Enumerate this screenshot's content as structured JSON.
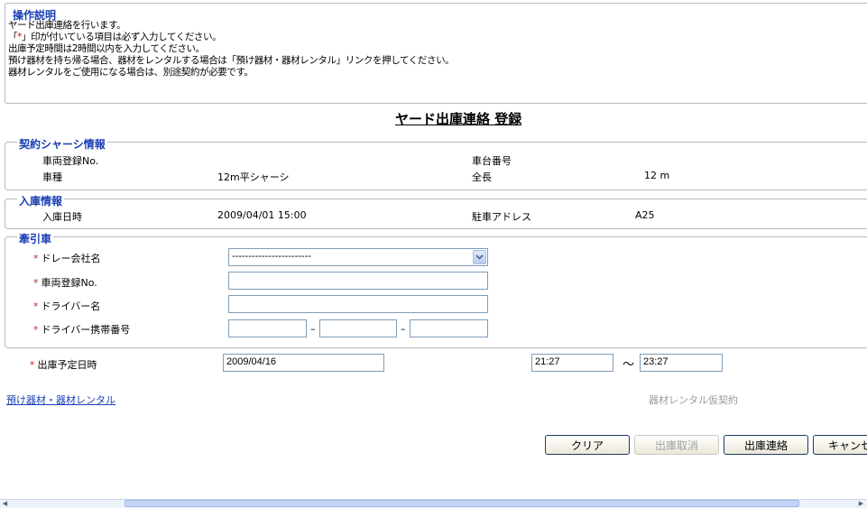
{
  "instructions": {
    "title": "操作説明",
    "line1": "ヤード出庫連絡を行います。",
    "line2_pre": "「",
    "line2_star": "*",
    "line2_post": "」印が付いている項目は必ず入力してください。",
    "line3": "出庫予定時間は2時間以内を入力してください。",
    "line4": "預け器材を持ち帰る場合、器材をレンタルする場合は「預け器材・器材レンタル」リンクを押してください。",
    "line5": "器材レンタルをご使用になる場合は、別途契約が必要です。"
  },
  "page_title": "ヤード出庫連絡 登録",
  "chassis": {
    "legend": "契約シャーシ情報",
    "reg_no_label": "車両登録No.",
    "reg_no_value": "",
    "car_number_label": "車台番号",
    "car_number_value": "",
    "type_label": "車種",
    "type_value": "12m平シャーシ",
    "length_label": "全長",
    "length_value": "12 m"
  },
  "entry": {
    "legend": "入庫情報",
    "datetime_label": "入庫日時",
    "datetime_value": "2009/04/01 15:00",
    "parking_label": "駐車アドレス",
    "parking_value": "A25"
  },
  "tractor": {
    "legend": "牽引車",
    "required_mark": "*",
    "company_label": "ドレー会社名",
    "company_selected": "------------------------",
    "reg_no_label": "車両登録No.",
    "reg_no_value": "",
    "driver_label": "ドライバー名",
    "driver_value": "",
    "phone_label": "ドライバー携帯番号",
    "phone_1": "",
    "phone_2": "",
    "phone_3": "",
    "phone_sep": "–"
  },
  "departure": {
    "label": "出庫予定日時",
    "date_value": "2009/04/16",
    "time_from": "21:27",
    "tilde": "～",
    "time_to": "23:27"
  },
  "links": {
    "rental": "預け器材・器材レンタル",
    "rental_contract": "器材レンタル仮契約"
  },
  "buttons": {
    "clear": "クリア",
    "cancel_exit": "出庫取消",
    "submit": "出庫連絡",
    "cancel": "キャンセル"
  },
  "icons": {
    "select_arrow": "chevron-down-icon"
  }
}
